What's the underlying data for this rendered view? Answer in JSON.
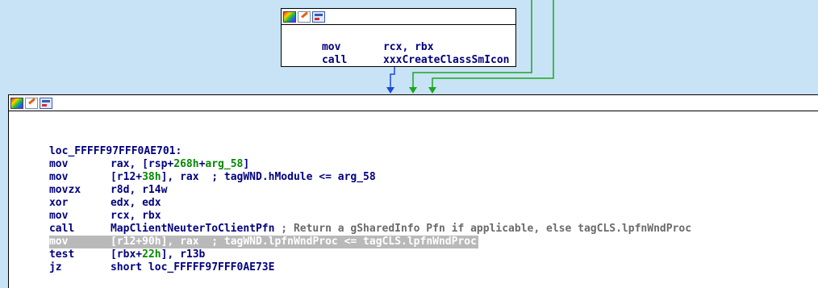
{
  "top_node": {
    "lines": [
      {
        "mnemonic": "mov",
        "operands": "rcx, rbx"
      },
      {
        "mnemonic": "call",
        "operands": "xxxCreateClassSmIcon"
      }
    ]
  },
  "main_node": {
    "label": "loc_FFFFF97FFF0AE701:",
    "lines": [
      {
        "mnemonic": "mov",
        "op1": "rax, [rsp+",
        "num1": "268h",
        "op2": "+",
        "num2": "arg_58",
        "op3": "]",
        "comment": ""
      },
      {
        "mnemonic": "mov",
        "op1": "[r12+",
        "num1": "38h",
        "op2": "], rax",
        "num2": "",
        "op3": "",
        "comment": "  ; tagWND.hModule <= arg_58"
      },
      {
        "mnemonic": "movzx",
        "op1": "r8d, r14w",
        "num1": "",
        "op2": "",
        "num2": "",
        "op3": "",
        "comment": ""
      },
      {
        "mnemonic": "xor",
        "op1": "edx, edx",
        "num1": "",
        "op2": "",
        "num2": "",
        "op3": "",
        "comment": ""
      },
      {
        "mnemonic": "mov",
        "op1": "rcx, rbx",
        "num1": "",
        "op2": "",
        "num2": "",
        "op3": "",
        "comment": ""
      },
      {
        "mnemonic": "call",
        "op1": "MapClientNeuterToClientPfn",
        "num1": "",
        "op2": "",
        "num2": "",
        "op3": "",
        "comment": " ; Return a gSharedInfo Pfn if applicable, else tagCLS.lpfnWndProc"
      },
      {
        "mnemonic": "mov",
        "op1": "[r12+",
        "num1": "90h",
        "op2": "], rax",
        "num2": "",
        "op3": "",
        "comment": "  ; tagWND.lpfnWndProc <= tagCLS.lpfnWndProc"
      },
      {
        "mnemonic": "test",
        "op1": "[rbx+",
        "num1": "22h",
        "op2": "], r13b",
        "num2": "",
        "op3": "",
        "comment": ""
      },
      {
        "mnemonic": "jz",
        "op1": "short loc_FFFFF97FFF0AE73E",
        "num1": "",
        "op2": "",
        "num2": "",
        "op3": "",
        "comment": ""
      }
    ],
    "highlighted_line_index": 6
  },
  "colors": {
    "background": "#c8e3f5",
    "edge_blue": "#1c49d4",
    "edge_green": "#1ea51e",
    "highlight": "#b9b9b9"
  },
  "icons": [
    "color-palette-icon",
    "rename-pencil-icon",
    "graph-view-icon"
  ]
}
